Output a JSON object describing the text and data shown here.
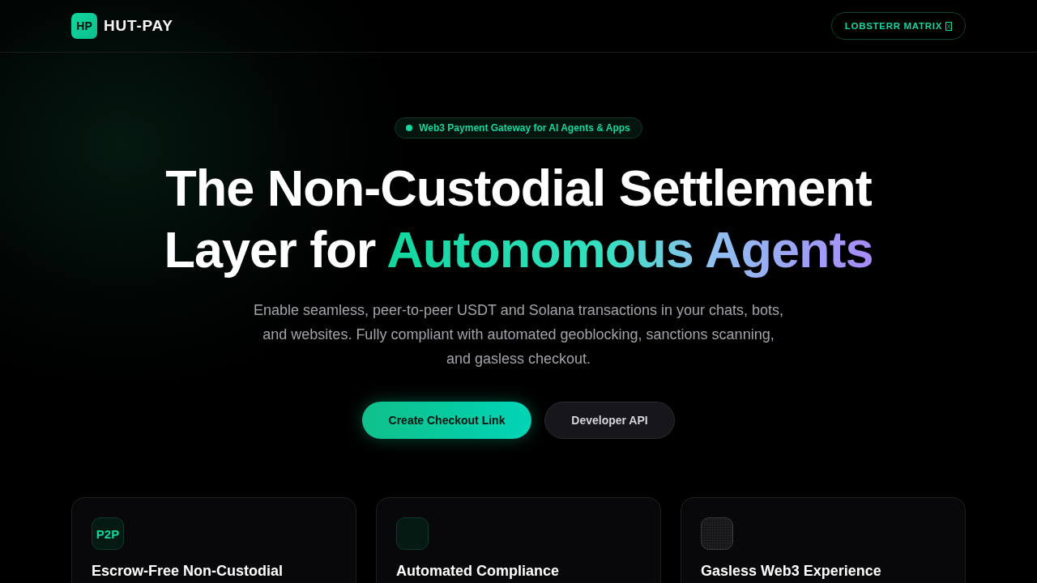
{
  "header": {
    "logo": {
      "mark": "HP",
      "name": "HUT-PAY"
    },
    "action": {
      "label": "LOBSTERR MATRIX"
    }
  },
  "hero": {
    "badge": "Web3 Payment Gateway for AI Agents & Apps",
    "headline": "The Non-Custodial Settlement Layer for",
    "headline_highlight": "Autonomous Agents",
    "description": "Enable seamless, peer-to-peer USDT and Solana transactions in your chats, bots, and websites. Fully compliant with automated geoblocking, sanctions scanning, and gasless checkout.",
    "buttons": [
      {
        "label": "Create Checkout Link",
        "kind": "primary"
      },
      {
        "label": "Developer API",
        "kind": "secondary"
      }
    ]
  },
  "features": [
    {
      "icon": {
        "kind": "text",
        "label": "P2P"
      },
      "title": "Escrow-Free Non-Custodial"
    },
    {
      "icon": {
        "kind": "plain"
      },
      "title": "Automated Compliance"
    },
    {
      "icon": {
        "kind": "dotted"
      },
      "title": "Gasless Web3 Experience"
    }
  ]
}
